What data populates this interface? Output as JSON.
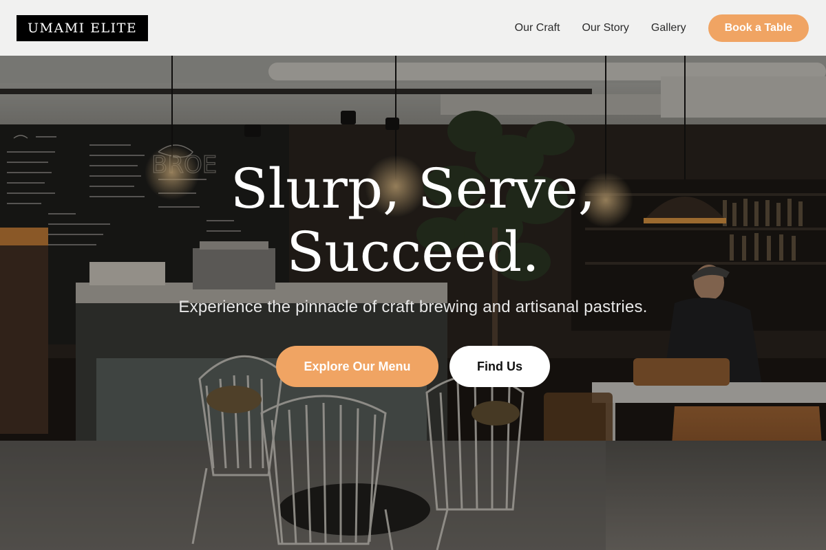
{
  "brand": {
    "name": "UMAMI ELITE"
  },
  "nav": {
    "links": [
      "Our Craft",
      "Our Story",
      "Gallery"
    ],
    "cta_label": "Book a Table"
  },
  "hero": {
    "title_line1": "Slurp, Serve,",
    "title_line2": "Succeed.",
    "subtitle": "Experience the pinnacle of craft brewing and artisanal pastries.",
    "primary_cta": "Explore Our Menu",
    "secondary_cta": "Find Us"
  },
  "colors": {
    "accent": "#f0a463",
    "header_bg": "#f1f1f0",
    "logo_bg": "#000000"
  }
}
